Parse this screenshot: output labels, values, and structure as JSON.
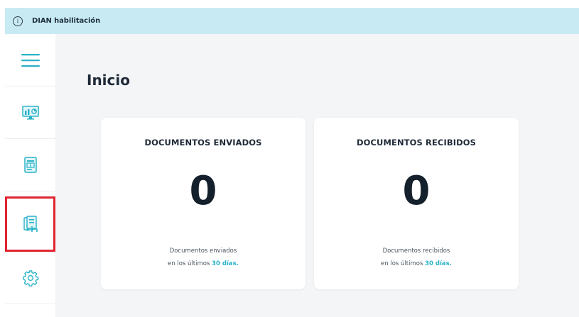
{
  "banner": {
    "icon": "info-icon",
    "text": "DIAN habilitación"
  },
  "sidebar": {
    "items": [
      {
        "name": "menu-icon",
        "color": "#2bb3c8"
      },
      {
        "name": "dashboard-monitor-icon",
        "color": "#2bb3c8"
      },
      {
        "name": "document-icon",
        "color": "#2bb3c8"
      },
      {
        "name": "documents-received-icon",
        "color": "#2bb3c8",
        "active": true
      },
      {
        "name": "gear-icon",
        "color": "#2bb3c8"
      }
    ],
    "active_highlight_color": "#e0242f"
  },
  "main": {
    "title": "Inicio",
    "cards": [
      {
        "title": "DOCUMENTOS ENVIADOS",
        "count": "0",
        "desc_line1": "Documentos enviados",
        "desc_line2_prefix": "en los últimos ",
        "desc_line2_highlight": "30 días."
      },
      {
        "title": "DOCUMENTOS RECIBIDOS",
        "count": "0",
        "desc_line1": "Documentos recibidos",
        "desc_line2_prefix": "en los últimos ",
        "desc_line2_highlight": "30 días."
      }
    ]
  },
  "colors": {
    "accent": "#2bb3c8",
    "banner_bg": "#c8ebf3",
    "main_bg": "#f3f5f7"
  }
}
